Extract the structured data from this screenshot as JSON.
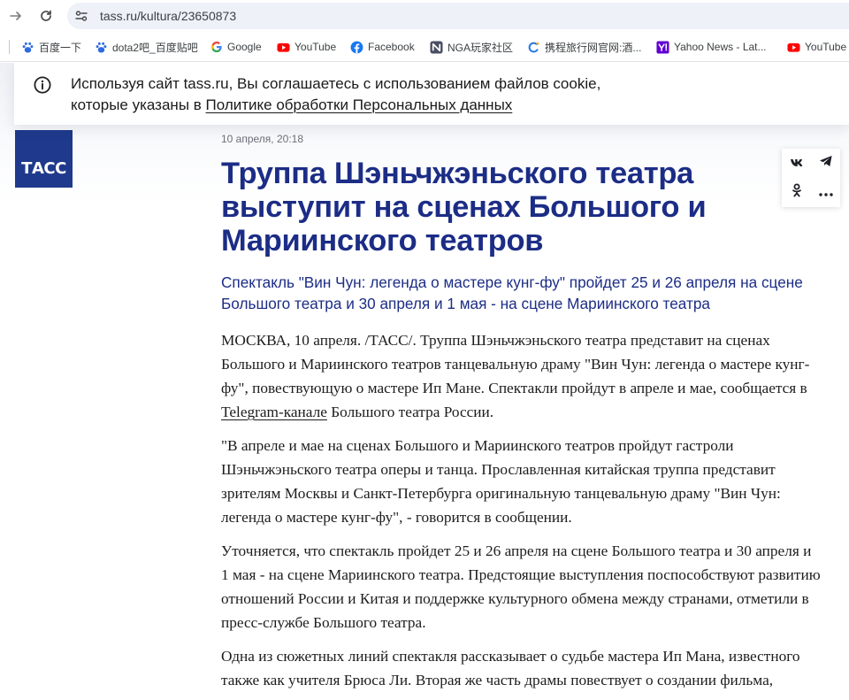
{
  "browser": {
    "url": "tass.ru/kultura/23650873",
    "bookmarks": [
      {
        "label": "百度一下",
        "icon": "baidu-paw-icon",
        "color": "#2f6be0"
      },
      {
        "label": "dota2吧_百度贴吧",
        "icon": "baidu-paw-icon",
        "color": "#2f6be0"
      },
      {
        "label": "Google",
        "icon": "google-g-icon",
        "color": "#4285f4"
      },
      {
        "label": "YouTube",
        "icon": "youtube-icon",
        "color": "#ff0000"
      },
      {
        "label": "Facebook",
        "icon": "facebook-icon",
        "color": "#1877f2"
      },
      {
        "label": "NGA玩家社区",
        "icon": "nga-icon",
        "color": "#4a4f63"
      },
      {
        "label": "携程旅行网官网:酒...",
        "icon": "ctrip-icon",
        "color": "#2b7be4"
      },
      {
        "label": "Yahoo News - Lat...",
        "icon": "yahoo-icon",
        "color": "#6001d2"
      },
      {
        "label": "YouTube",
        "icon": "youtube-icon",
        "color": "#ff0000"
      }
    ]
  },
  "cookie_banner": {
    "text": "Используя сайт tass.ru, Вы соглашаетесь с использованием файлов cookie, которые указаны в ",
    "link_text": "Политике обработки Персональных данных"
  },
  "logo": {
    "text": "ТАСС",
    "color": "#1f3a8c"
  },
  "article": {
    "date": "10 апреля, 20:18",
    "headline": "Труппа Шэньчжэньского театра выступит на сценах Большого и Мариинского театров",
    "subtitle": "Спектакль \"Вин Чун: легенда о мастере кунг-фу\" пройдет 25 и 26 апреля на сцене Большого театра и 30 апреля и 1 мая - на сцене Мариинского театра",
    "paragraphs": [
      {
        "before": "МОСКВА, 10 апреля. /ТАСС/. Труппа Шэньчжэньского театра представит на сценах Большого и Мариинского театров танцевальную драму \"Вин Чун: легенда о мастере кунг-фу\", повествующую о мастере Ип Мане. Спектакли пройдут в апреле и мае, сообщается в ",
        "link": "Telegram-канале",
        "after": " Большого театра России."
      },
      {
        "text": "\"В апреле и мае на сценах Большого и Мариинского театров пройдут гастроли Шэньчжэньского театра оперы и танца. Прославленная китайская труппа представит зрителям Москвы и Санкт-Петербурга оригинальную танцевальную драму \"Вин Чун: легенда о мастере кунг-фу\", - говорится в сообщении."
      },
      {
        "text": "Уточняется, что спектакль пройдет 25 и 26 апреля на сцене Большого театра и 30 апреля и 1 мая - на сцене Мариинского театра. Предстоящие выступления поспособствуют развитию отношений России и Китая и поддержке культурного обмена между странами, отметили в пресс-службе Большого театра."
      },
      {
        "text": "Одна из сюжетных линий спектакля рассказывает о судьбе мастера Ип Мана, известного также как учителя Брюса Ли. Вторая же часть драмы повествует о создании фильма, вдохновленного жизнью мастера."
      }
    ]
  },
  "share": {
    "buttons": [
      {
        "icon": "vk-icon",
        "label": "VK"
      },
      {
        "icon": "telegram-icon",
        "label": "Telegram"
      },
      {
        "icon": "odnoklassniki-icon",
        "label": "Одноклассники"
      },
      {
        "icon": "more-icon",
        "label": "Ещё"
      }
    ]
  },
  "colors": {
    "headline": "#1c2d86",
    "logo_bg": "#1f3a8c",
    "banner_shade": "#eef0f6"
  }
}
